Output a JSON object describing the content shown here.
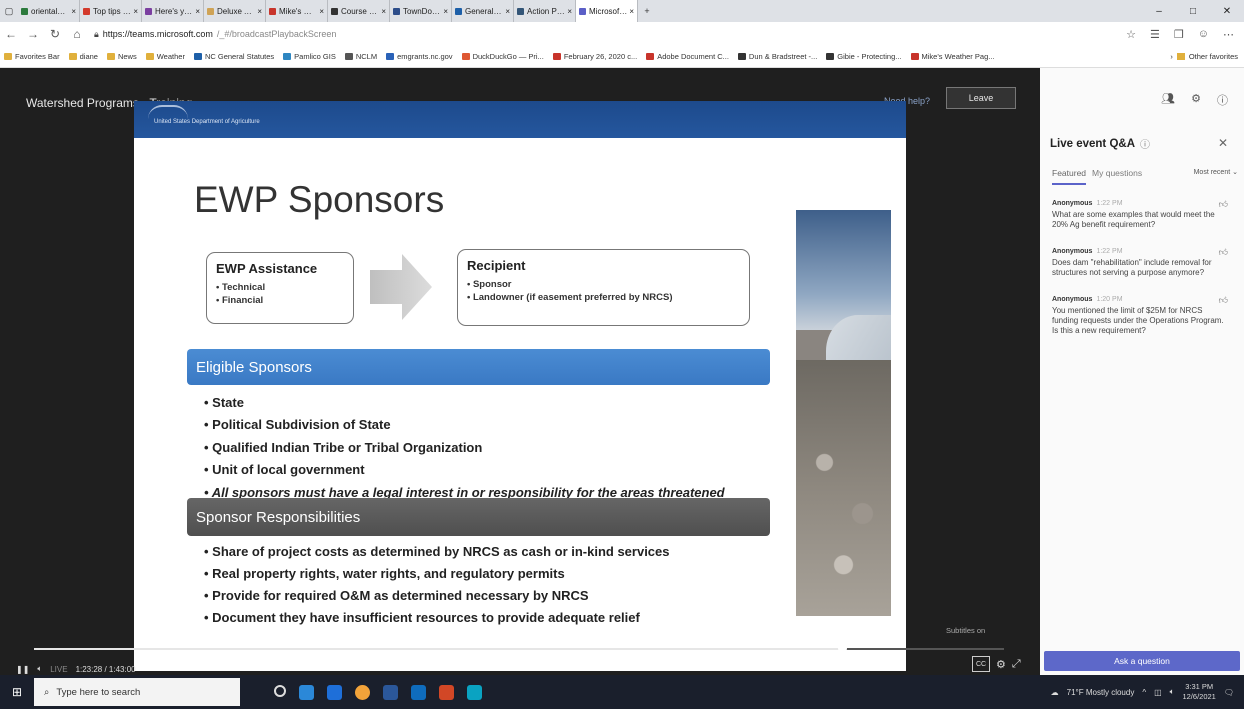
{
  "browser": {
    "tabs": [
      {
        "label": "orientalnc.gov/N...",
        "color": "#2c7a3d",
        "active": false
      },
      {
        "label": "Top tips on buying",
        "color": "#d33a2c",
        "active": false
      },
      {
        "label": "Here's your Gift Li",
        "color": "#7b3fa0",
        "active": false
      },
      {
        "label": "Deluxe Antipasto",
        "color": "#cfa356",
        "active": false
      },
      {
        "label": "Mike's Weather Pa",
        "color": "#c8342b",
        "active": false
      },
      {
        "label": "Course builds self",
        "color": "#333333",
        "active": false
      },
      {
        "label": "TownDock.net | O",
        "color": "#2d4d8a",
        "active": false
      },
      {
        "label": "General Statute O",
        "color": "#1d5fa8",
        "active": false
      },
      {
        "label": "Action Plans | Reli",
        "color": "#335577",
        "active": false
      },
      {
        "label": "Microsoft Te",
        "color": "#5b5fc7",
        "active": true
      }
    ],
    "url_domain": "https://teams.microsoft.com",
    "url_path": "/_#/broadcastPlaybackScreen",
    "favorites": [
      {
        "label": "Favorites Bar",
        "color": "#e0b03c"
      },
      {
        "label": "diane",
        "color": "#e0b03c"
      },
      {
        "label": "News",
        "color": "#e0b03c"
      },
      {
        "label": "Weather",
        "color": "#e0b03c"
      },
      {
        "label": "NC General Statutes",
        "color": "#1d5fa8"
      },
      {
        "label": "Pamlico GIS",
        "color": "#2e86c1"
      },
      {
        "label": "NCLM",
        "color": "#555555"
      },
      {
        "label": "emgrants.nc.gov",
        "color": "#2a62b8"
      },
      {
        "label": "DuckDuckGo — Pri...",
        "color": "#de5833"
      },
      {
        "label": "February 26, 2020 c...",
        "color": "#c8342b"
      },
      {
        "label": "Adobe Document C...",
        "color": "#c8342b"
      },
      {
        "label": "Dun & Bradstreet -...",
        "color": "#333333"
      },
      {
        "label": "Gibie - Protecting...",
        "color": "#333333"
      },
      {
        "label": "Mike's Weather Pag...",
        "color": "#c8342b"
      }
    ],
    "other_favorites": "Other favorites"
  },
  "player": {
    "title": "Watershed Programs - Training",
    "need_help": "Need help?",
    "leave": "Leave",
    "subtitles": "Subtitles on",
    "live": "LIVE",
    "time": "1:23:28 / 1:43:00"
  },
  "slide": {
    "agency": "United States Department of Agriculture",
    "title": "EWP Sponsors",
    "assistance": {
      "heading": "EWP Assistance",
      "items": [
        "Technical",
        "Financial"
      ]
    },
    "recipient": {
      "heading": "Recipient",
      "items": [
        "Sponsor",
        "Landowner (if easement preferred by NRCS)"
      ]
    },
    "eligible_heading": "Eligible Sponsors",
    "eligible_items": [
      "State",
      "Political Subdivision of State",
      "Qualified Indian Tribe or Tribal Organization",
      "Unit of local government"
    ],
    "eligible_note": "All sponsors must have a legal interest in or responsibility for the areas threatened",
    "resp_heading": "Sponsor Responsibilities",
    "resp_items": [
      "Share of project costs as determined by NRCS as cash or in-kind services",
      "Real property rights, water rights, and regulatory permits",
      "Provide for required O&M as determined necessary by NRCS",
      "Document they have insufficient resources to provide adequate relief"
    ]
  },
  "qa": {
    "title": "Live event Q&A",
    "tab_featured": "Featured",
    "tab_my": "My questions",
    "sort": "Most recent",
    "questions": [
      {
        "author": "Anonymous",
        "time": "1:22 PM",
        "text": "What are some examples that would meet the 20% Ag benefit requirement?"
      },
      {
        "author": "Anonymous",
        "time": "1:22 PM",
        "text": "Does dam \"rehabilitation\" include removal for structures not serving a purpose anymore?"
      },
      {
        "author": "Anonymous",
        "time": "1:20 PM",
        "text": "You mentioned the limit of $25M for NRCS funding requests under the Operations Program. Is this a new requirement?"
      }
    ],
    "ask": "Ask a question"
  },
  "taskbar": {
    "search_placeholder": "Type here to search",
    "weather": "71°F Mostly cloudy",
    "time": "3:31 PM",
    "date": "12/6/2021"
  }
}
